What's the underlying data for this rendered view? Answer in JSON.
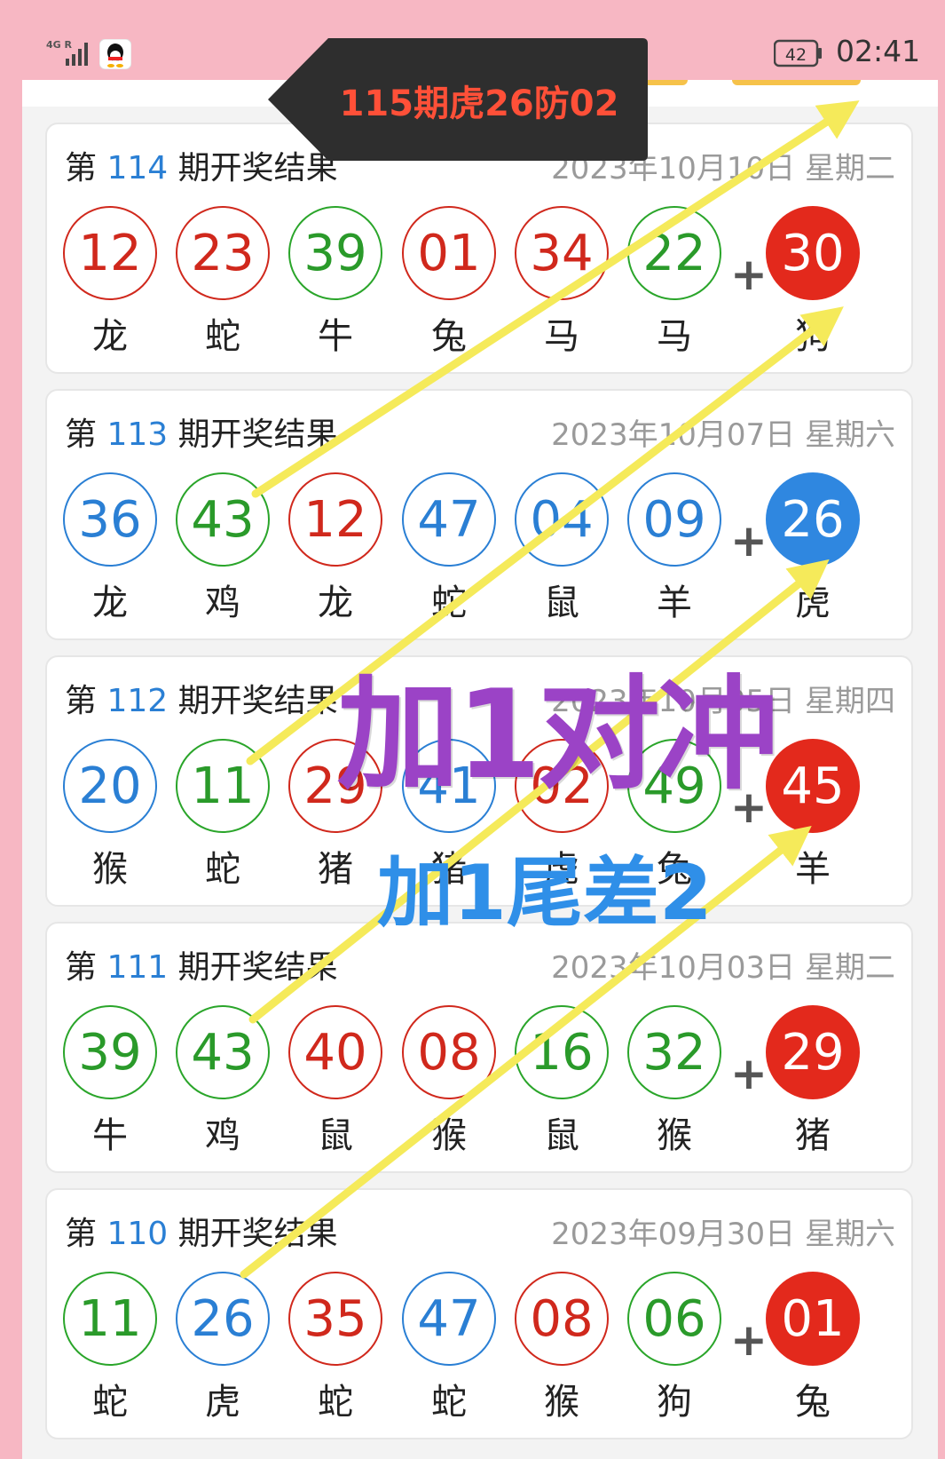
{
  "status_bar": {
    "network": "4G R",
    "battery": "42",
    "time": "02:41"
  },
  "cards": [
    {
      "prefix": "第",
      "issue": "114",
      "suffix": "期开奖结果",
      "date": "2023年10月10日 星期二",
      "balls": [
        {
          "num": "12",
          "color": "red",
          "zodiac": "龙"
        },
        {
          "num": "23",
          "color": "red",
          "zodiac": "蛇"
        },
        {
          "num": "39",
          "color": "green",
          "zodiac": "牛"
        },
        {
          "num": "01",
          "color": "red",
          "zodiac": "兔"
        },
        {
          "num": "34",
          "color": "red",
          "zodiac": "马"
        },
        {
          "num": "22",
          "color": "green",
          "zodiac": "马"
        }
      ],
      "special": {
        "num": "30",
        "color": "red",
        "zodiac": "狗"
      }
    },
    {
      "prefix": "第",
      "issue": "113",
      "suffix": "期开奖结果",
      "date": "2023年10月07日 星期六",
      "balls": [
        {
          "num": "36",
          "color": "blue",
          "zodiac": "龙"
        },
        {
          "num": "43",
          "color": "green",
          "zodiac": "鸡"
        },
        {
          "num": "12",
          "color": "red",
          "zodiac": "龙"
        },
        {
          "num": "47",
          "color": "blue",
          "zodiac": "蛇"
        },
        {
          "num": "04",
          "color": "blue",
          "zodiac": "鼠"
        },
        {
          "num": "09",
          "color": "blue",
          "zodiac": "羊"
        }
      ],
      "special": {
        "num": "26",
        "color": "blue",
        "zodiac": "虎"
      }
    },
    {
      "prefix": "第",
      "issue": "112",
      "suffix": "期开奖结果",
      "date": "2023年10月05日 星期四",
      "balls": [
        {
          "num": "20",
          "color": "blue",
          "zodiac": "猴"
        },
        {
          "num": "11",
          "color": "green",
          "zodiac": "蛇"
        },
        {
          "num": "29",
          "color": "red",
          "zodiac": "猪"
        },
        {
          "num": "41",
          "color": "blue",
          "zodiac": "猪"
        },
        {
          "num": "02",
          "color": "red",
          "zodiac": "虎"
        },
        {
          "num": "49",
          "color": "green",
          "zodiac": "兔"
        }
      ],
      "special": {
        "num": "45",
        "color": "red",
        "zodiac": "羊"
      }
    },
    {
      "prefix": "第",
      "issue": "111",
      "suffix": "期开奖结果",
      "date": "2023年10月03日 星期二",
      "balls": [
        {
          "num": "39",
          "color": "green",
          "zodiac": "牛"
        },
        {
          "num": "43",
          "color": "green",
          "zodiac": "鸡"
        },
        {
          "num": "40",
          "color": "red",
          "zodiac": "鼠"
        },
        {
          "num": "08",
          "color": "red",
          "zodiac": "猴"
        },
        {
          "num": "16",
          "color": "green",
          "zodiac": "鼠"
        },
        {
          "num": "32",
          "color": "green",
          "zodiac": "猴"
        }
      ],
      "special": {
        "num": "29",
        "color": "red",
        "zodiac": "猪"
      }
    },
    {
      "prefix": "第",
      "issue": "110",
      "suffix": "期开奖结果",
      "date": "2023年09月30日 星期六",
      "balls": [
        {
          "num": "11",
          "color": "green",
          "zodiac": "蛇"
        },
        {
          "num": "26",
          "color": "blue",
          "zodiac": "虎"
        },
        {
          "num": "35",
          "color": "red",
          "zodiac": "蛇"
        },
        {
          "num": "47",
          "color": "blue",
          "zodiac": "蛇"
        },
        {
          "num": "08",
          "color": "red",
          "zodiac": "猴"
        },
        {
          "num": "06",
          "color": "green",
          "zodiac": "狗"
        }
      ],
      "special": {
        "num": "01",
        "color": "red",
        "zodiac": "兔"
      }
    }
  ],
  "plus_sign": "+",
  "annotations": {
    "bubble_text": "115期虎26防02",
    "big_text": "加1对冲",
    "sub_text": "加1尾差2",
    "arrow_color": "#f5ea5a"
  },
  "icons": {
    "signal": "signal-icon",
    "qq": "qq-penguin-icon",
    "battery": "battery-icon"
  }
}
